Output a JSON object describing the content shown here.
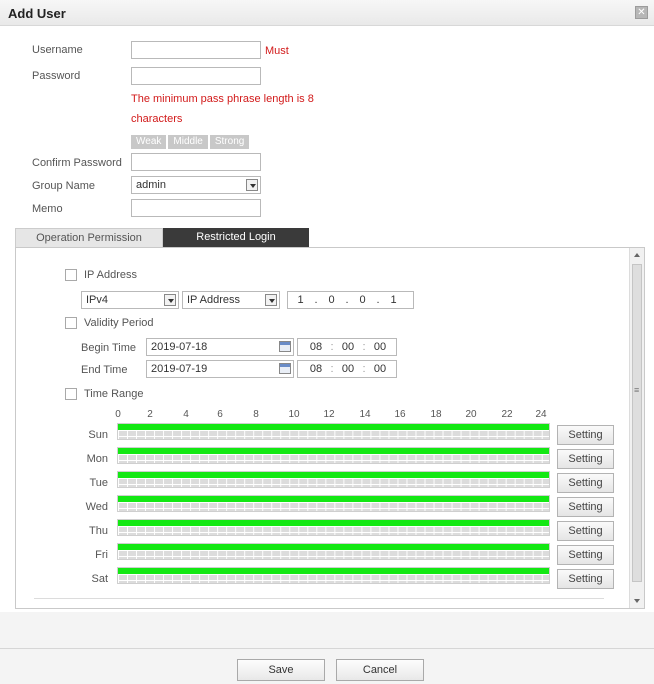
{
  "window": {
    "title": "Add User",
    "close": "✕"
  },
  "form": {
    "username_label": "Username",
    "username_value": "",
    "must_label": "Must",
    "password_label": "Password",
    "password_value": "",
    "password_hint_line1": "The minimum pass phrase length is 8",
    "password_hint_line2": "characters",
    "strength": [
      "Weak",
      "Middle",
      "Strong"
    ],
    "confirm_label": "Confirm Password",
    "confirm_value": "",
    "group_label": "Group Name",
    "group_value": "admin",
    "memo_label": "Memo",
    "memo_value": ""
  },
  "tabs": [
    {
      "label": "Operation Permission",
      "active": false
    },
    {
      "label": "Restricted Login",
      "active": true
    }
  ],
  "restricted": {
    "ip_address_label": "IP Address",
    "ip_version": "IPv4",
    "ip_type": "IP Address",
    "ip_octets": [
      "1",
      "0",
      "0",
      "1"
    ],
    "validity_label": "Validity Period",
    "begin_label": "Begin Time",
    "begin_date": "2019-07-18",
    "begin_time": [
      "08",
      "00",
      "00"
    ],
    "end_label": "End Time",
    "end_date": "2019-07-19",
    "end_time": [
      "08",
      "00",
      "00"
    ],
    "time_range_label": "Time Range",
    "hours": [
      "0",
      "2",
      "4",
      "6",
      "8",
      "10",
      "12",
      "14",
      "16",
      "18",
      "20",
      "22",
      "24"
    ],
    "days": [
      "Sun",
      "Mon",
      "Tue",
      "Wed",
      "Thu",
      "Fri",
      "Sat"
    ],
    "setting_label": "Setting",
    "active_color": "#13e813"
  },
  "footer": {
    "save": "Save",
    "cancel": "Cancel"
  }
}
